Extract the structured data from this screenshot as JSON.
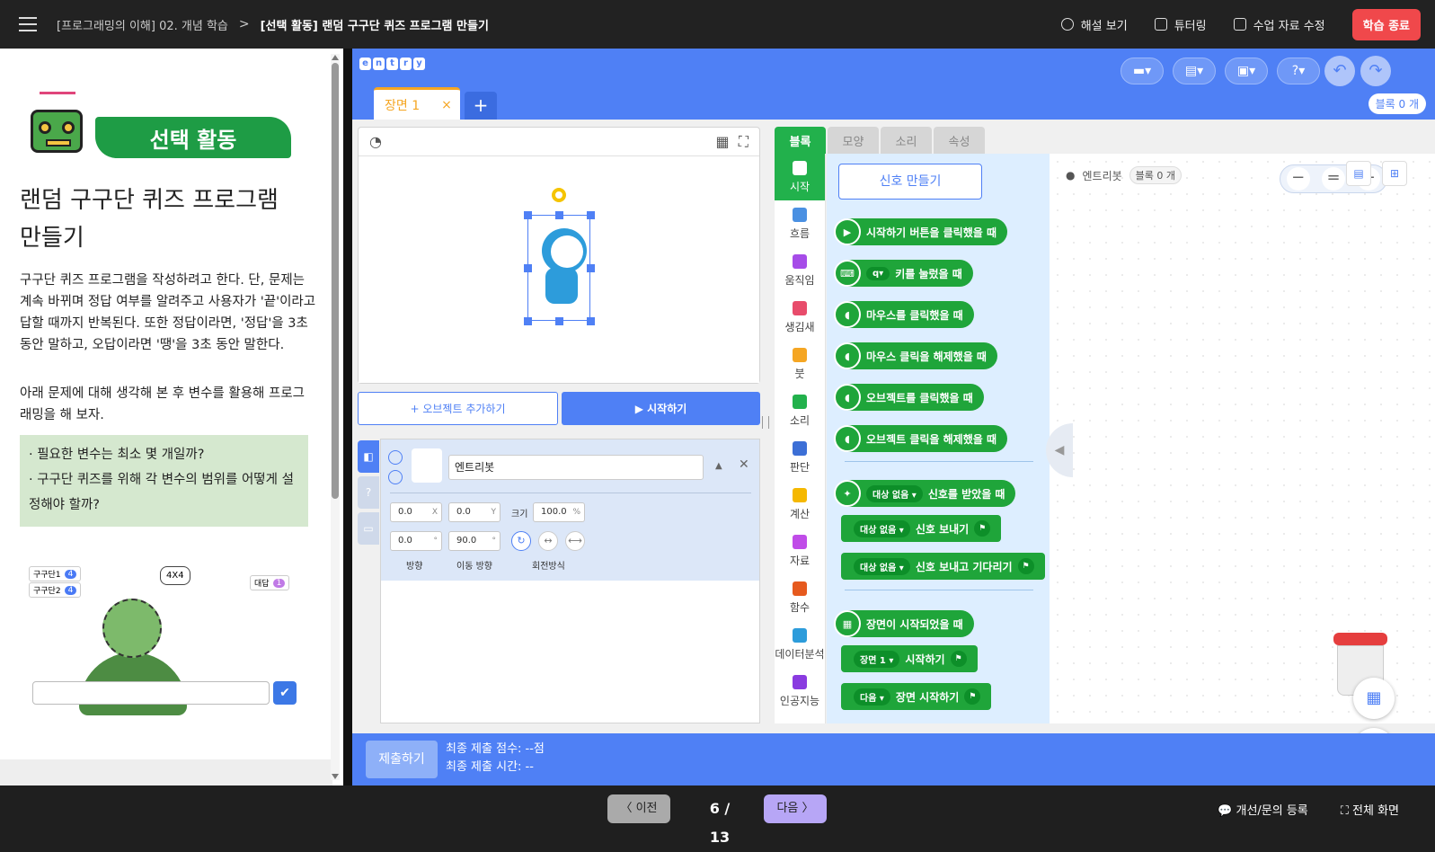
{
  "header": {
    "breadcrumb_parent": "[프로그래밍의 이해] 02. 개념 학습",
    "breadcrumb_sep": ">",
    "breadcrumb_current": "[선택 활동] 랜덤 구구단 퀴즈 프로그램 만들기",
    "actions": [
      "해설 보기",
      "튜터링",
      "수업 자료 수정"
    ],
    "end_label": "학습 종료"
  },
  "lesson": {
    "badge": "선택 활동",
    "title": "랜덤 구구단 퀴즈 프로그램 만들기",
    "para1": "구구단 퀴즈 프로그램을 작성하려고 한다. 단, 문제는 계속 바뀌며 정답 여부를 알려주고 사용자가 '끝'이라고 답할 때까지 반복된다. 또한 정답이라면, '정답'을 3초 동안 말하고, 오답이라면 '땡'을 3초 동안 말한다.",
    "para2": "아래 문제에 대해 생각해 본 후 변수를 활용해 프로그래밍을 해 보자.",
    "hints": [
      "· 필요한 변수는 최소 몇 개일까?",
      "· 구구단 퀴즈를 위해 각 변수의 범위를 어떻게 설정해야 할까?"
    ],
    "preview": {
      "var1_label": "구구단1",
      "var1_value": "4",
      "var2_label": "구구단2",
      "var2_value": "4",
      "answer_label": "대답",
      "answer_value": "1",
      "bubble": "4X4",
      "ok_icon": "✔"
    }
  },
  "entry": {
    "logo_letters": [
      "e",
      "n",
      "t",
      "r",
      "y"
    ],
    "block_count_label": "블록 0 개",
    "scene_tab": "장면 1",
    "scene_close": "×",
    "scene_add": "+",
    "add_object": "+ 오브젝트 추가하기",
    "start": "▶ 시작하기",
    "object": {
      "name": "엔트리봇",
      "x": "0.0",
      "x_unit": "X",
      "y": "0.0",
      "y_unit": "Y",
      "size_label": "크기",
      "size": "100.0",
      "size_unit": "%",
      "direction": "0.0",
      "move_direction": "90.0",
      "deg": "°",
      "direction_label": "방향",
      "move_direction_label": "이동 방향",
      "rotation_label": "회전방식"
    },
    "block_tabs": [
      "블록",
      "모양",
      "소리",
      "속성"
    ],
    "categories": [
      {
        "label": "시작",
        "color": "#ffffff"
      },
      {
        "label": "흐름",
        "color": "#4a90e2"
      },
      {
        "label": "움직임",
        "color": "#a64ce8"
      },
      {
        "label": "생김새",
        "color": "#e84c6b"
      },
      {
        "label": "붓",
        "color": "#f5a623"
      },
      {
        "label": "소리",
        "color": "#22b14c"
      },
      {
        "label": "판단",
        "color": "#3c6fd6"
      },
      {
        "label": "계산",
        "color": "#f5b800"
      },
      {
        "label": "자료",
        "color": "#c04ce8"
      },
      {
        "label": "함수",
        "color": "#e65a1e"
      },
      {
        "label": "데이터분석",
        "color": "#2d9cdb"
      },
      {
        "label": "인공지능",
        "color": "#8a3be0"
      }
    ],
    "signal_button": "신호 만들기",
    "blocks": {
      "b1": "시작하기 버튼을 클릭했을 때",
      "b2_key": "q",
      "b2": "키를 눌렀을 때",
      "b3": "마우스를 클릭했을 때",
      "b4": "마우스 클릭을 해제했을 때",
      "b5": "오브젝트를 클릭했을 때",
      "b6": "오브젝트 클릭을 해제했을 때",
      "none": "대상 없음",
      "b7": "신호를 받았을 때",
      "b8": "신호 보내기",
      "b9": "신호 보내고 기다리기",
      "b10": "장면이 시작되었을 때",
      "scene1": "장면 1",
      "b11": "시작하기",
      "next": "다음",
      "b12": "장면 시작하기"
    },
    "canvas": {
      "object_name": "엔트리봇",
      "block_count": "블록 0 개",
      "zoom_out": "−",
      "zoom_reset": "=",
      "zoom_in": "+"
    }
  },
  "submit": {
    "button": "제출하기",
    "score": "최종 제출 점수: --점",
    "time": "최종 제출 시간: --"
  },
  "footer": {
    "prev": "〈  이전",
    "page": "6 / 13",
    "next": "다음  〉",
    "report": "개선/문의 등록",
    "fullscreen": "전체 화면"
  }
}
